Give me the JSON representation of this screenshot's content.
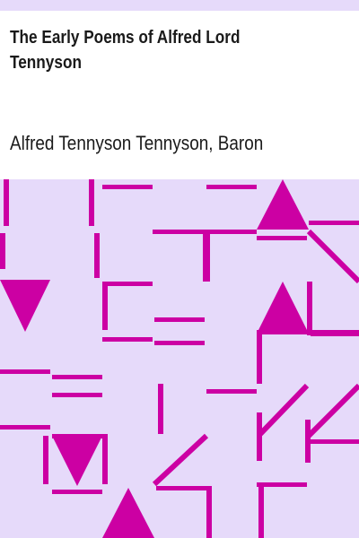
{
  "cover": {
    "title": "The Early Poems of Alfred Lord Tennyson",
    "author": "Alfred Tennyson Tennyson, Baron",
    "colors": {
      "pattern_background": "#e6dafa",
      "pattern_ink": "#cc00a3",
      "text": "#1a1a1a"
    }
  }
}
